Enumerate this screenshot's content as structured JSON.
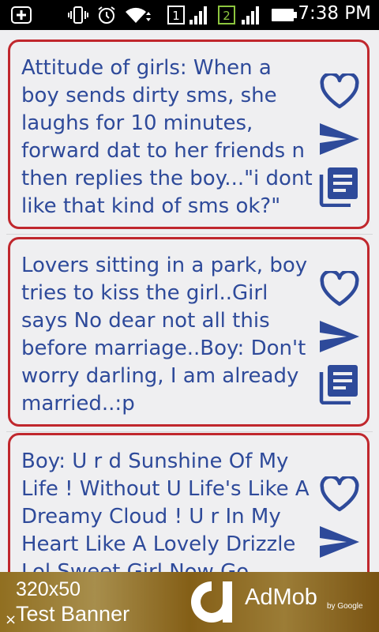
{
  "status_bar": {
    "time": "7:38 PM",
    "icons": [
      "add-notification-icon",
      "vibrate-icon",
      "alarm-icon",
      "wifi-icon",
      "sim1-icon",
      "signal1-icon",
      "sim2-icon",
      "signal2-icon",
      "battery-icon"
    ],
    "sim1_label": "1",
    "sim2_label": "2"
  },
  "messages": [
    {
      "text": "Attitude of girls: When a\nboy sends dirty sms, she\nlaughs for 10 minutes,\nforward dat to her friends n\nthen replies the boy...\"i dont\nlike that kind of sms ok?\""
    },
    {
      "text": "Lovers sitting in a park, boy\ntries to kiss the girl..Girl\nsays No dear not all this\nbefore marriage..Boy: Don't\nworry darling, I am already\nmarried..:p"
    },
    {
      "text": "Boy: U r d Sunshine Of My\nLife ! Without U Life's Like A\nDreamy Cloud ! U r In My\nHeart Like A Lovely Drizzle\nLol Sweet Girl Now Go"
    }
  ],
  "actions": [
    "favorite-icon",
    "send-icon",
    "copy-icon"
  ],
  "colors": {
    "accent_text": "#2e4a9a",
    "card_border": "#c0272d",
    "icon_blue": "#2e4a9a"
  },
  "ad": {
    "size": "320x50",
    "label": "Test Banner",
    "close": "×",
    "brand": "AdMob",
    "by": "by Google"
  }
}
